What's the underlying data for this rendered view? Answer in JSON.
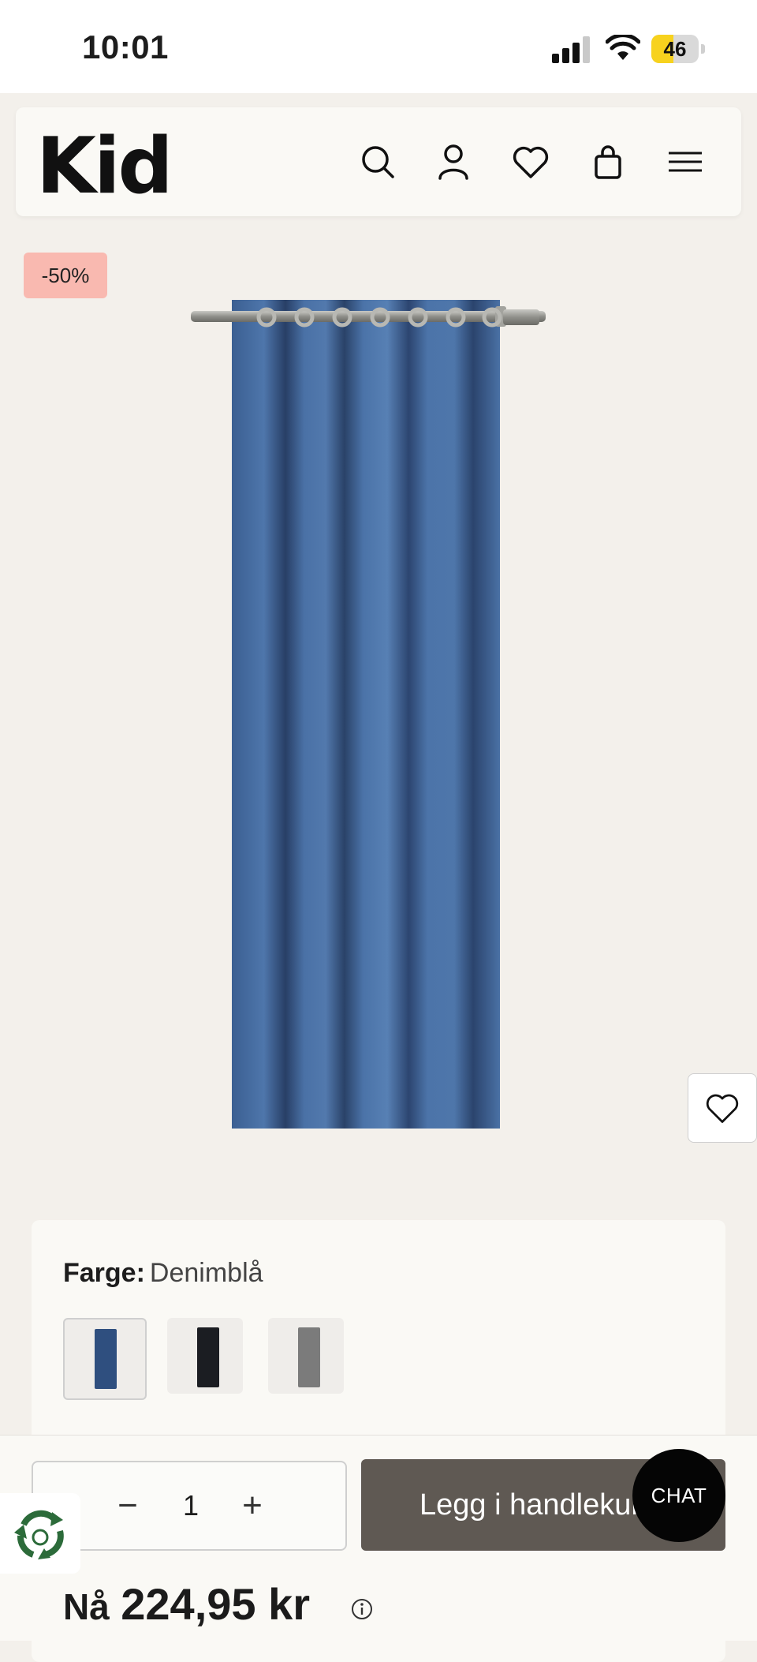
{
  "status_bar": {
    "time": "10:01",
    "battery": "46",
    "battery_level": 0.46
  },
  "header": {
    "logo": "Kid",
    "icons": [
      "search-icon",
      "account-icon",
      "heart-icon",
      "bag-icon",
      "menu-icon"
    ]
  },
  "product": {
    "discount_badge": "-50%",
    "image": "blue-curtain-panel",
    "curtain_color": "#4a6fa0"
  },
  "options": {
    "color_label": "Farge:",
    "color_value": "Denimblå",
    "swatches": [
      {
        "name": "denim-blue",
        "color": "#2f4f7f",
        "selected": true
      },
      {
        "name": "black",
        "color": "#1b1d22",
        "selected": false
      },
      {
        "name": "grey",
        "color": "#7b7b7b",
        "selected": false
      }
    ]
  },
  "cart": {
    "quantity": "1",
    "add_to_cart": "Legg i handlekurv",
    "chat": "CHAT"
  },
  "price": {
    "prefix": "Nå",
    "amount": "224,95 kr"
  },
  "colors": {
    "accent_button": "#5f5953",
    "badge": "#f9b9b0",
    "page_bg": "#f3f0eb"
  }
}
